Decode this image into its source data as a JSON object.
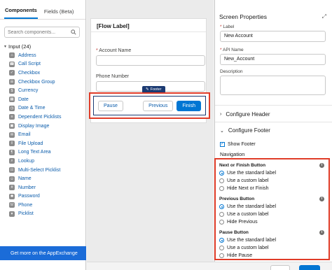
{
  "left_panel": {
    "tabs": [
      {
        "label": "Components"
      },
      {
        "label": "Fields (Beta)"
      }
    ],
    "search_placeholder": "Search components...",
    "section": {
      "label": "Input (24)"
    },
    "items": [
      {
        "label": "Address",
        "icon": "address-icon"
      },
      {
        "label": "Call Script",
        "icon": "call-script-icon"
      },
      {
        "label": "Checkbox",
        "icon": "checkbox-icon"
      },
      {
        "label": "Checkbox Group",
        "icon": "checkbox-group-icon"
      },
      {
        "label": "Currency",
        "icon": "currency-icon"
      },
      {
        "label": "Date",
        "icon": "date-icon"
      },
      {
        "label": "Date & Time",
        "icon": "date-time-icon"
      },
      {
        "label": "Dependent Picklists",
        "icon": "dependent-picklists-icon"
      },
      {
        "label": "Display Image",
        "icon": "display-image-icon"
      },
      {
        "label": "Email",
        "icon": "email-icon"
      },
      {
        "label": "File Upload",
        "icon": "file-upload-icon"
      },
      {
        "label": "Long Text Area",
        "icon": "long-text-area-icon"
      },
      {
        "label": "Lookup",
        "icon": "lookup-icon"
      },
      {
        "label": "Multi-Select Picklist",
        "icon": "multi-select-picklist-icon"
      },
      {
        "label": "Name",
        "icon": "name-icon"
      },
      {
        "label": "Number",
        "icon": "number-icon"
      },
      {
        "label": "Password",
        "icon": "password-icon"
      },
      {
        "label": "Phone",
        "icon": "phone-icon"
      },
      {
        "label": "Picklist",
        "icon": "picklist-icon"
      }
    ],
    "appexchange": "Get more on the AppExchange"
  },
  "canvas": {
    "flow_label": "[Flow Label]",
    "field1_label": "Account Name",
    "field2_label": "Phone Number",
    "footer_badge": "Footer",
    "buttons": {
      "pause": "Pause",
      "previous": "Previous",
      "finish": "Finish"
    }
  },
  "right_panel": {
    "title": "Screen Properties",
    "label_field": {
      "label": "Label",
      "value": "New Account"
    },
    "api_field": {
      "label": "API Name",
      "value": "New_Account"
    },
    "description_label": "Description",
    "configure_header": "Configure Header",
    "configure_footer": "Configure Footer",
    "show_footer": "Show Footer",
    "navigation": "Navigation",
    "groups": [
      {
        "title": "Next or Finish Button",
        "options": [
          "Use the standard label",
          "Use a custom label",
          "Hide Next or Finish"
        ],
        "selected": 0
      },
      {
        "title": "Previous Button",
        "options": [
          "Use the standard label",
          "Use a custom label",
          "Hide Previous"
        ],
        "selected": 0
      },
      {
        "title": "Pause Button",
        "options": [
          "Use the standard label",
          "Use a custom label",
          "Hide Pause"
        ],
        "selected": 0
      }
    ]
  },
  "colors": {
    "accent": "#0176d3",
    "highlight": "#e03c28",
    "navy": "#1b3a72"
  }
}
